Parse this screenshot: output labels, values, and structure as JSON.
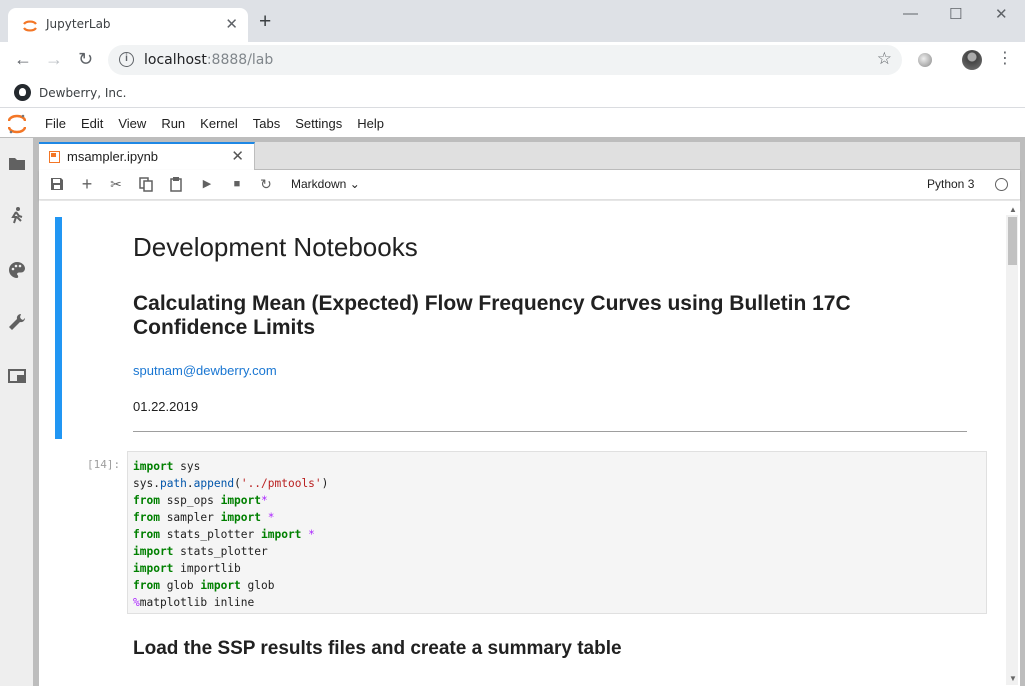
{
  "browser": {
    "tab_title": "JupyterLab",
    "tab_close": "✕",
    "new_tab": "+",
    "url_host": "localhost",
    "url_rest": ":8888/lab",
    "bookmark": "Dewberry, Inc.",
    "window_controls": [
      "—",
      "☐",
      "✕"
    ]
  },
  "jupyter": {
    "menu": [
      "File",
      "Edit",
      "View",
      "Run",
      "Kernel",
      "Tabs",
      "Settings",
      "Help"
    ],
    "doc_tab": "msampler.ipynb",
    "cell_type": "Markdown",
    "kernel_name": "Python 3"
  },
  "notebook": {
    "h1": "Development Notebooks",
    "h2": "Calculating Mean (Expected) Flow Frequency Curves using Bulletin 17C Confidence Limits",
    "email": "sputnam@dewberry.com",
    "date": "01.22.2019",
    "prompt": "[14]:",
    "next_heading": "Load the SSP results files and create a summary table"
  },
  "colors": {
    "accent": "#2196f3",
    "jupyter_orange": "#f37626",
    "keyword": "#008000",
    "string": "#ba2121"
  }
}
